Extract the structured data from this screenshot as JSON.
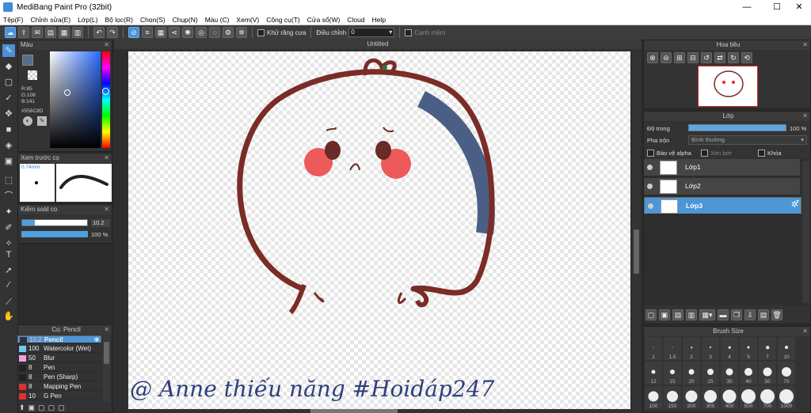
{
  "window": {
    "title": "MediBang Paint Pro (32bit)",
    "min": "—",
    "max": "☐",
    "close": "✕"
  },
  "menu": [
    "Tệp(F)",
    "Chỉnh sửa(E)",
    "Lớp(L)",
    "Bộ lọc(R)",
    "Chọn(S)",
    "Chụp(N)",
    "Màu (C)",
    "Xem(V)",
    "Công cụ(T)",
    "Cửa sổ(W)",
    "Cloud",
    "Help"
  ],
  "toolbar": {
    "antialias_label": "Khử răng cưa",
    "correction_label": "Điều chỉnh",
    "correction_value": "0",
    "snap_label": "Cạnh mềm"
  },
  "color_panel": {
    "title": "Màu",
    "r": "R:85",
    "g": "G:108",
    "b": "B:141",
    "hex": "#556C8D",
    "main_color": "#556C8D"
  },
  "brush_preview": {
    "title": "Xem trước cọ",
    "size": "0.74mm"
  },
  "brush_control": {
    "title": "Kiểm soát cọ",
    "size_value": "10.2",
    "opacity_value": "100 %"
  },
  "brush_panel": {
    "title": "Cọ: Pencil",
    "items": [
      {
        "size": "10.2",
        "name": "Pencil",
        "color": "#333333"
      },
      {
        "size": "100",
        "name": "Watercolor (Wet)",
        "color": "#6fc8f0"
      },
      {
        "size": "50",
        "name": "Blur",
        "color": "#f0a0e0"
      },
      {
        "size": "8",
        "name": "Pen",
        "color": "#222222"
      },
      {
        "size": "8",
        "name": "Pen (Sharp)",
        "color": "#222222"
      },
      {
        "size": "8",
        "name": "Mapping Pen",
        "color": "#e03030"
      },
      {
        "size": "10",
        "name": "G Pen",
        "color": "#e03030"
      }
    ]
  },
  "document": {
    "tab": "Untitled",
    "watermark": "@ Anne thiếu năng   #Hoidáp247"
  },
  "navigator": {
    "title": "Hoa tiêu"
  },
  "layer_panel": {
    "title": "Lớp",
    "opacity_label": "Độ trong",
    "opacity_value": "100 %",
    "blend_label": "Pha trộn",
    "blend_value": "Bình thường",
    "protect_alpha": "Bảo vệ alpha",
    "clipping": "Xén bớt",
    "lock": "Khóa",
    "layers": [
      {
        "name": "Lớp1"
      },
      {
        "name": "Lớp2"
      },
      {
        "name": "Lớp3"
      }
    ]
  },
  "brush_size": {
    "title": "Brush Size",
    "sizes": [
      "1",
      "1.5",
      "2",
      "3",
      "4",
      "5",
      "7",
      "10",
      "12",
      "15",
      "20",
      "25",
      "30",
      "40",
      "50",
      "70",
      "100",
      "150",
      "200",
      "300",
      "400",
      "500",
      "700",
      "1000"
    ]
  }
}
